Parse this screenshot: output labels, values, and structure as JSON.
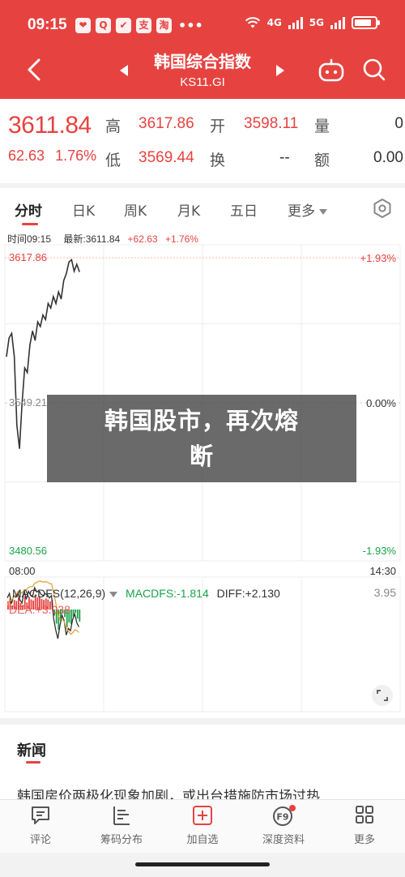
{
  "status_bar": {
    "time": "09:15",
    "app_icons": [
      "❤",
      "Q",
      "✔",
      "支",
      "淘"
    ],
    "more": "•••",
    "network_1": "4G",
    "network_2": "5G"
  },
  "header": {
    "title": "韩国综合指数",
    "code": "KS11.GI"
  },
  "quote": {
    "price": "3611.84",
    "change": "62.63",
    "change_pct": "1.76%",
    "high_label": "高",
    "high_value": "3617.86",
    "open_label": "开",
    "open_value": "3598.11",
    "volume_label": "量",
    "volume_value": "0",
    "low_label": "低",
    "low_value": "3569.44",
    "turnover_label": "换",
    "turnover_value": "--",
    "amount_label": "额",
    "amount_value": "0.00"
  },
  "tabs": [
    {
      "label": "分时",
      "active": true
    },
    {
      "label": "日K"
    },
    {
      "label": "周K"
    },
    {
      "label": "月K"
    },
    {
      "label": "五日"
    },
    {
      "label": "更多"
    }
  ],
  "chart_info": {
    "time_text": "时间09:15",
    "latest_text": "最新:3611.84",
    "change_text": "+62.63",
    "pct_text": "+1.76%"
  },
  "chart_data": [
    {
      "type": "line",
      "title": "",
      "x_start": "09:15",
      "x_labels": [
        "08:00",
        "14:30"
      ],
      "y_labels": [
        "3617.86",
        "3549.21",
        "3480.56"
      ],
      "right_labels": [
        "+1.93%",
        "0.00%",
        "-1.93%"
      ],
      "ylim": [
        3480.56,
        3617.86
      ],
      "prev_close": 3549.21,
      "series": [
        {
          "values": [
            3575,
            3583,
            3585,
            3575,
            3545,
            3535,
            3555,
            3570,
            3568,
            3580,
            3586,
            3582,
            3590,
            3588,
            3593,
            3591,
            3598,
            3596,
            3601,
            3598,
            3603,
            3600,
            3608,
            3611,
            3616,
            3617,
            3612,
            3615,
            3611.84
          ]
        }
      ],
      "grid": true
    },
    {
      "type": "bar",
      "title": "MACDFS(12,26,9)",
      "indicator_label": "MACDFS:-1.814",
      "diff_label": "DIFF:+2.130",
      "dea_label": "DEA:+3.038",
      "right_label": "3.95",
      "values": [
        1.6,
        2.2,
        0.8,
        1.9,
        1.7,
        2.4,
        1.3,
        0.9,
        2.6,
        1.4,
        2.5,
        2.0,
        1.8,
        3.0,
        2.4,
        2.6,
        2.1,
        1.9,
        2.2,
        2.0,
        1.6,
        1.9,
        -1.2,
        -2.8,
        -4.0,
        -2.2,
        -0.8,
        -1.5,
        -3.5,
        -2.6,
        -2.9,
        -1.4,
        -0.6,
        -1.8,
        -2.4
      ]
    }
  ],
  "banner": {
    "line1": "韩国股市，再次熔",
    "line2": "断"
  },
  "news": {
    "section_title": "新闻",
    "items": [
      "韩国房价两极化现象加剧，或出台措施防市场过热"
    ]
  },
  "bottom_nav": [
    {
      "label": "评论",
      "icon": "comment-icon"
    },
    {
      "label": "筹码分布",
      "icon": "chip-distribution-icon"
    },
    {
      "label": "加自选",
      "icon": "add-watchlist-icon"
    },
    {
      "label": "深度资料",
      "icon": "f9-icon"
    },
    {
      "label": "更多",
      "icon": "more-grid-icon"
    }
  ],
  "colors": {
    "brand_red": "#e64340",
    "up": "#e64340",
    "down": "#1aa34a"
  }
}
